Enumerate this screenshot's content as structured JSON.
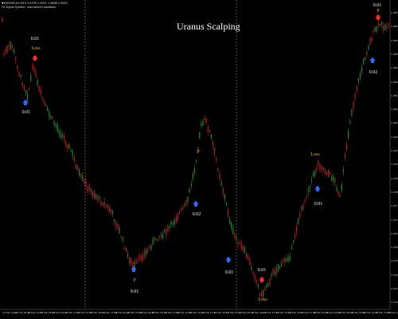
{
  "window": {
    "info_line_1": "▼EURUSD,H4 M15 1.0799 1.0921 1.0888 1.0929",
    "info_line_2": "FX Signal System: uranusSco0 positions",
    "title": "Uranus Scalping"
  },
  "colors": {
    "background": "#000000",
    "bull_candle": "#1f8a2e",
    "bear_candle": "#b51f1f",
    "separator": "#8a8a8a",
    "buy_arrow": "#2a6bff",
    "sell_arrow": "#ff2a2a",
    "loss_text": "#ffb000",
    "lot_text": "#ffffff"
  },
  "signals": [
    {
      "id": "s1",
      "arrow": "down",
      "lot": "0.01",
      "result": "Loss"
    },
    {
      "id": "s2",
      "arrow": "up",
      "lot": "0.01",
      "result": ""
    },
    {
      "id": "s3",
      "arrow": "up",
      "lot": "0.02",
      "result": "P"
    },
    {
      "id": "s4",
      "arrow": "up",
      "lot": "0.01",
      "result": "P"
    },
    {
      "id": "s5",
      "arrow": "up",
      "lot": "0.01",
      "result": ""
    },
    {
      "id": "s6",
      "arrow": "down",
      "lot": "0.01",
      "result": "Loss"
    },
    {
      "id": "s7",
      "arrow": "up",
      "lot": "0.01",
      "result": "Loss"
    },
    {
      "id": "s8",
      "arrow": "up",
      "lot": "0.02",
      "result": ""
    },
    {
      "id": "s9",
      "arrow": "down",
      "lot": "0.01",
      "result": "P"
    }
  ],
  "price_axis": [
    "1.0845",
    "1.0840",
    "1.0835",
    "1.0830",
    "1.0825",
    "1.0820",
    "1.0815",
    "1.0810",
    "1.0805",
    "1.0800",
    "1.0795",
    "1.0790",
    "1.0785",
    "1.0780",
    "1.0775",
    "1.0770",
    "1.0765",
    "1.0760",
    "1.0755",
    "1.0750",
    "1.0745",
    "1.0740"
  ],
  "time_axis": [
    "24 Feb 2014",
    "25 Feb 00:15",
    "25 Feb 03:15",
    "25 Feb 06:15",
    "25 Feb 09:15",
    "25 Feb 12:15",
    "25 Feb 15:15",
    "25 Feb 18:15",
    "25 Feb 21:15",
    "26 Feb 00:15",
    "26 Feb 03:15",
    "26 Feb 06:15",
    "26 Feb 09:15",
    "26 Feb 12:15",
    "26 Feb 15:15",
    "26 Feb 18:15",
    "26 Feb 21:15",
    "27 Feb 00:15",
    "27 Feb 03:15",
    "27 Feb 06:15",
    "27 Feb 09:15",
    "27 Feb 12:15",
    "27 Feb 15:15",
    "27 Feb 18:15",
    "27 Feb 21:15",
    "28 Feb 00:15",
    "28 Feb 03:15",
    "28 Feb 06:15",
    "28 Feb 09:15",
    "28 Feb 12:15",
    "28 Feb 15:15",
    "28 Feb 18:15"
  ]
}
